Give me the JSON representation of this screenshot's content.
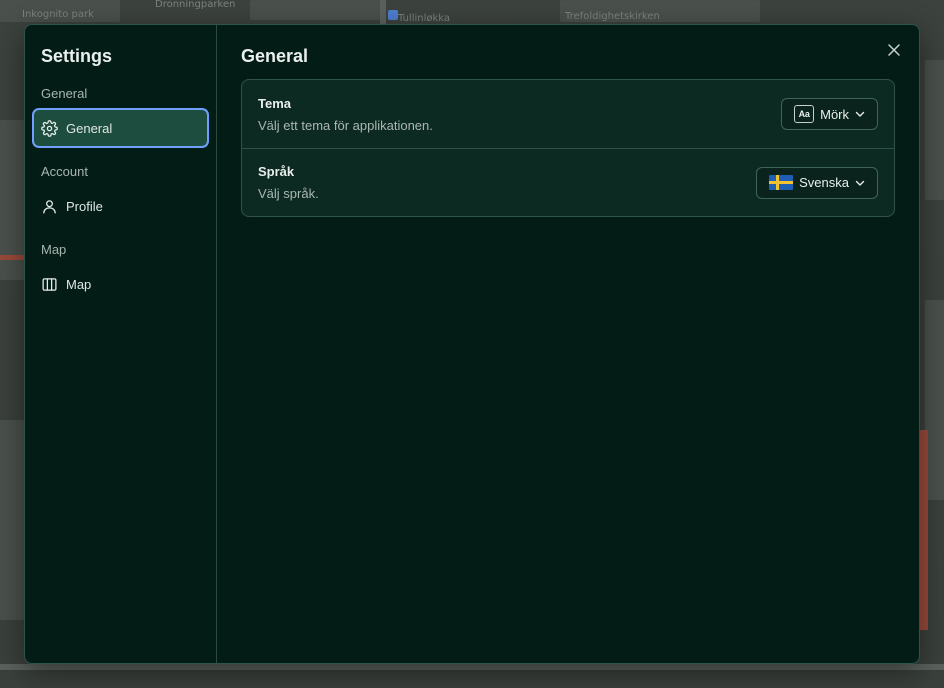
{
  "map": {
    "labels": [
      "Inkognito park",
      "Dronningparken",
      "Tullinløkka",
      "Trefoldighetskirken"
    ]
  },
  "sidebar": {
    "title": "Settings",
    "groups": [
      {
        "label": "General",
        "items": [
          {
            "label": "General",
            "icon": "gear-icon",
            "active": true
          }
        ]
      },
      {
        "label": "Account",
        "items": [
          {
            "label": "Profile",
            "icon": "user-icon",
            "active": false
          }
        ]
      },
      {
        "label": "Map",
        "items": [
          {
            "label": "Map",
            "icon": "map-icon",
            "active": false
          }
        ]
      }
    ]
  },
  "main": {
    "title": "General",
    "close_icon": "close-icon",
    "settings": [
      {
        "title": "Tema",
        "description": "Välj ett tema för applikationen.",
        "control": {
          "badge": "Aa",
          "value": "Mörk",
          "icon": "chevron-down-icon"
        }
      },
      {
        "title": "Språk",
        "description": "Välj språk.",
        "control": {
          "flag": "sweden-flag-icon",
          "value": "Svenska",
          "icon": "chevron-down-icon"
        }
      }
    ]
  },
  "colors": {
    "modal_bg": "#041c16",
    "card_bg": "#0c2a22",
    "active_item": "#1d4d3e",
    "focus_ring": "#6fa0ff",
    "border": "#2f5447"
  }
}
